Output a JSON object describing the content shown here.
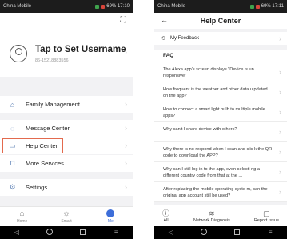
{
  "status": {
    "carrier": "China Mobile",
    "right": "69% 17:10",
    "right2": "69% 17:11"
  },
  "left": {
    "profile": {
      "username": "Tap to Set Username",
      "phone": "86-15218883556"
    },
    "menu": [
      {
        "label": "Family Management"
      },
      {
        "label": "Message Center"
      },
      {
        "label": "Help Center"
      },
      {
        "label": "More Services"
      },
      {
        "label": "Settings"
      }
    ],
    "tabs": [
      {
        "label": "Home"
      },
      {
        "label": "Smart"
      },
      {
        "label": "Me"
      }
    ]
  },
  "right": {
    "title": "Help Center",
    "feedback": "My Feedback",
    "faq_heading": "FAQ",
    "questions": [
      "The Alexa app's screen displays \"Device is un responsive\"",
      "How frequent is the weather and other data u pdated on the app?",
      "How to connect a smart light bulb to multiple mobile apps?",
      "Why can't I share device with others?",
      "Why there is no respond when I scan and clic k the QR code to download the APP?",
      "Why can I still log in to the app, even selecti ng a different country code from that at the ...",
      "After replacing the mobile operating syste m, can the original app account still be used?"
    ],
    "bottom_tabs": [
      {
        "label": "All"
      },
      {
        "label": "Network Diagnosis"
      },
      {
        "label": "Report Issue"
      }
    ]
  },
  "colors": {
    "accent": "#3d6ed9",
    "highlight": "#e36a4e",
    "status_bar": "#1c1c1c"
  }
}
